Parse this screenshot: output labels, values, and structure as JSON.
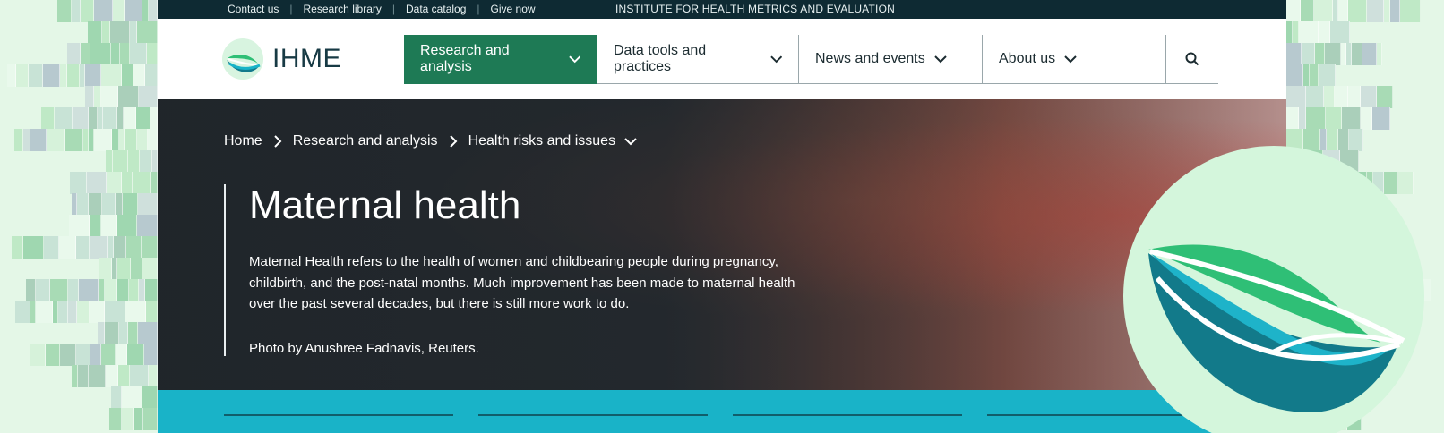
{
  "topbar": {
    "links": [
      "Contact us",
      "Research library",
      "Data catalog",
      "Give now"
    ],
    "institute": "INSTITUTE FOR HEALTH METRICS AND EVALUATION"
  },
  "logo": {
    "text": "IHME",
    "icon": "ihme-logo-icon"
  },
  "nav": {
    "items": [
      "Research and analysis",
      "Data tools and practices",
      "News and events",
      "About us"
    ],
    "search_icon": "search-icon",
    "active_color": "#1e7a55"
  },
  "breadcrumb": {
    "items": [
      "Home",
      "Research and analysis",
      "Health risks and issues"
    ]
  },
  "hero": {
    "title": "Maternal health",
    "description": "Maternal Health refers to the health of women and childbearing people during pregnancy, childbirth, and the post-natal months. Much improvement has been made to maternal health over the past several decades, but there is still more work to do.",
    "credit": "Photo by Anushree Fadnavis, Reuters."
  },
  "colors": {
    "topbar": "#0e2a33",
    "accent_green": "#1e7a55",
    "teal": "#19b3c8",
    "mint": "#e4f7e7"
  }
}
